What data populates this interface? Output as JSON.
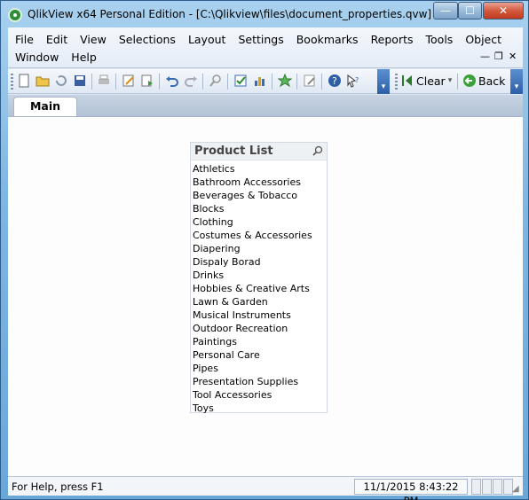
{
  "window": {
    "title": "QlikView x64 Personal Edition - [C:\\Qlikview\\files\\document_properties.qvw]",
    "minimize_label": "—",
    "maximize_label": "☐",
    "close_label": "✕"
  },
  "menubar": {
    "row1": [
      "File",
      "Edit",
      "View",
      "Selections",
      "Layout",
      "Settings",
      "Bookmarks",
      "Reports",
      "Tools",
      "Object"
    ],
    "row2": [
      "Window",
      "Help"
    ],
    "mdi_minimize": "—",
    "mdi_restore": "❐",
    "mdi_close": "✕"
  },
  "toolbar": {
    "clear_label": "Clear",
    "back_label": "Back",
    "icons": [
      "new-icon",
      "open-icon",
      "reload-icon",
      "save-icon",
      "print-icon",
      "edit-script-icon",
      "reload-script-icon",
      "undo-icon",
      "redo-icon",
      "search-icon",
      "select-icon",
      "chart-wizard-icon",
      "favorite-icon",
      "edit-object-icon",
      "help-icon",
      "pointer-help-icon"
    ]
  },
  "tabs": [
    {
      "label": "Main"
    }
  ],
  "listbox": {
    "title": "Product List",
    "items": [
      "Athletics",
      "Bathroom Accessories",
      "Beverages & Tobacco",
      "Blocks",
      "Clothing",
      "Costumes & Accessories",
      "Diapering",
      "Dispaly Borad",
      "Drinks",
      "Hobbies & Creative Arts",
      "Lawn & Garden",
      "Musical Instruments",
      "Outdoor Recreation",
      "Paintings",
      "Personal Care",
      "Pipes",
      "Presentation Supplies",
      "Tool Accessories",
      "Toys"
    ]
  },
  "statusbar": {
    "help_text": "For Help, press F1",
    "datetime": "11/1/2015 8:43:22 PM"
  },
  "colors": {
    "accent": "#2c5fa6",
    "titlebar": "#7fb6e2"
  }
}
